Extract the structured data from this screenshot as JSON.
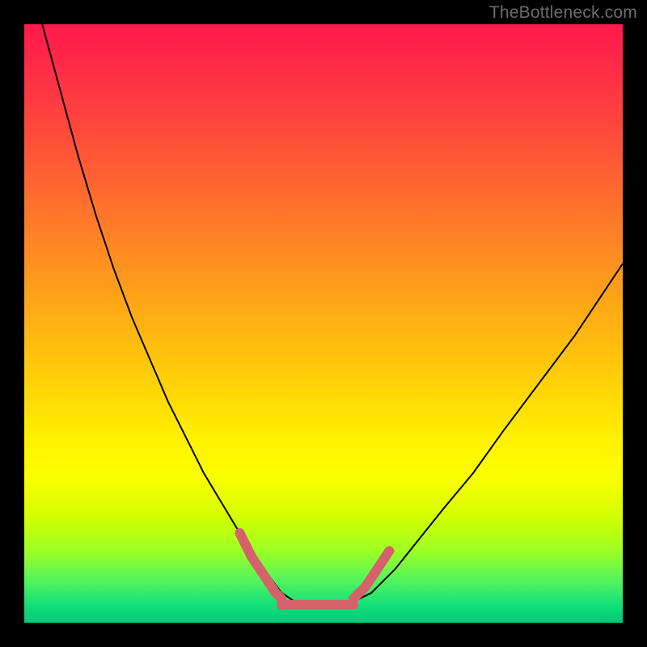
{
  "watermark": "TheBottleneck.com",
  "chart_data": {
    "type": "line",
    "title": "",
    "xlabel": "",
    "ylabel": "",
    "xlim": [
      0,
      100
    ],
    "ylim": [
      0,
      100
    ],
    "grid": false,
    "background_gradient": {
      "direction": "vertical",
      "stops": [
        {
          "pos": 0.0,
          "color": "#ff194c"
        },
        {
          "pos": 0.7,
          "color": "#fff300"
        },
        {
          "pos": 1.0,
          "color": "#00c877"
        }
      ]
    },
    "series": [
      {
        "name": "bottleneck-curve",
        "color": "#000000",
        "width": 2,
        "x": [
          3,
          6,
          9,
          12,
          15,
          18,
          21,
          24,
          27,
          30,
          33,
          36,
          38,
          40,
          43,
          46,
          50,
          54,
          58,
          62,
          66,
          70,
          75,
          80,
          86,
          92,
          100
        ],
        "y": [
          100,
          89,
          78,
          68,
          59,
          51,
          44,
          37,
          31,
          25,
          20,
          15,
          12,
          9,
          5,
          3,
          3,
          3,
          5,
          9,
          14,
          19,
          25,
          32,
          40,
          48,
          60
        ]
      },
      {
        "name": "optimal-segment-left",
        "color": "#d5626a",
        "width": 12,
        "linecap": "round",
        "x": [
          36,
          38,
          40,
          42,
          43
        ],
        "y": [
          15,
          11,
          8,
          5,
          4
        ]
      },
      {
        "name": "optimal-segment-bottom",
        "color": "#d5626a",
        "width": 12,
        "linecap": "round",
        "x": [
          43,
          47,
          51,
          55
        ],
        "y": [
          3,
          3,
          3,
          3
        ]
      },
      {
        "name": "optimal-segment-right",
        "color": "#d5626a",
        "width": 12,
        "linecap": "round",
        "x": [
          55,
          57,
          59,
          61
        ],
        "y": [
          4,
          6,
          9,
          12
        ]
      }
    ]
  }
}
